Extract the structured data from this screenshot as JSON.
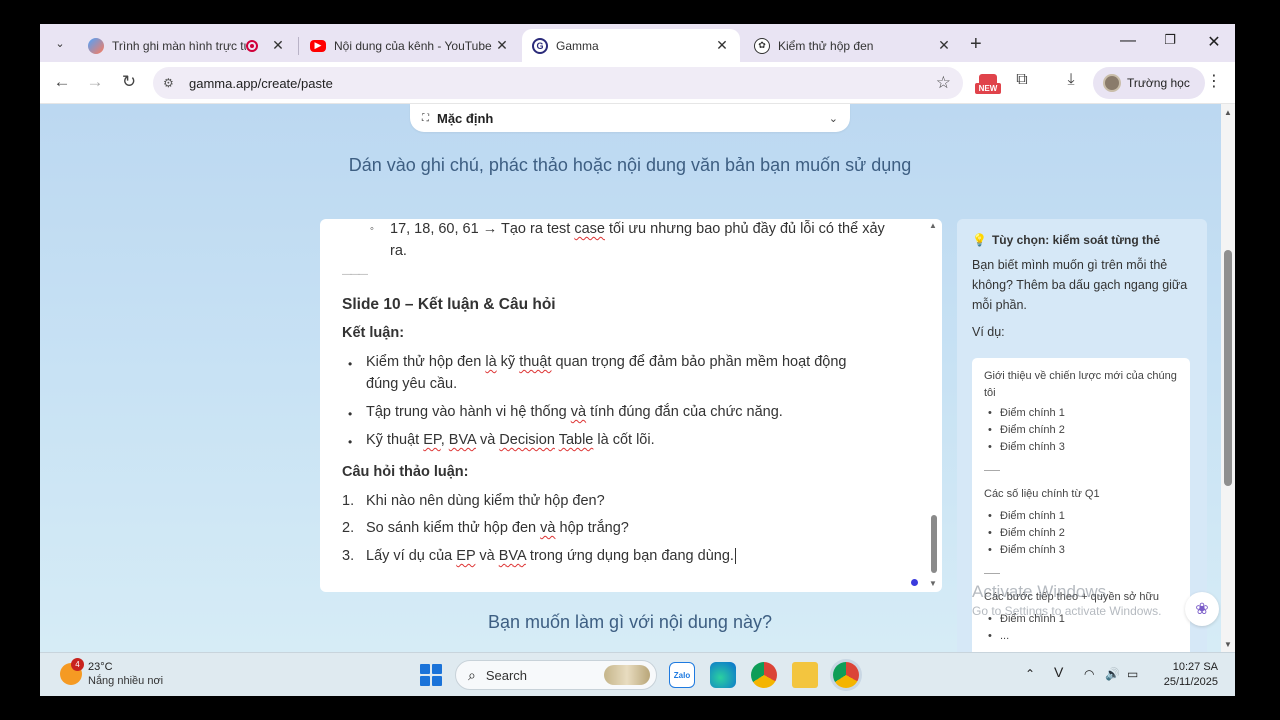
{
  "browser": {
    "tabs": [
      {
        "title": "Trình ghi màn hình trực tuyến",
        "active": false
      },
      {
        "title": "Nội dung của kênh - YouTube Studio",
        "active": false
      },
      {
        "title": "Gamma",
        "active": true
      },
      {
        "title": "Kiểm thử hộp đen",
        "active": false
      }
    ],
    "url": "gamma.app/create/paste",
    "new_badge": "NEW",
    "profile_name": "Trường học"
  },
  "page": {
    "mode_label": "Mặc định",
    "heading": "Dán vào ghi chú, phác thảo hoặc nội dung văn bản bạn muốn sử dụng",
    "question": "Bạn muốn làm gì với nội dung này?",
    "editor": {
      "sub_bullet_line1_pre": "17, 18, 60, 61 → Tạo ra test ",
      "sub_bullet_line1_err": "case",
      "sub_bullet_line1_post": " tối ưu nhưng bao phủ đầy đủ lỗi có thể xảy",
      "sub_bullet_line2": "ra.",
      "divider": "———",
      "slide_title": "Slide 10 – Kết luận & Câu hỏi",
      "conclusion_label": "Kết luận:",
      "bullet1_line1_pre": "Kiểm thử hộp đen ",
      "bullet1_line1_err": "là",
      "bullet1_line1_mid": " kỹ ",
      "bullet1_line1_err2": "thuật",
      "bullet1_line1_post": " quan trọng để đảm bảo phần mềm hoạt động",
      "bullet1_line2": "đúng yêu cầu.",
      "bullet2_pre": "Tập trung vào hành vi hệ thống ",
      "bullet2_err": "và",
      "bullet2_post": " tính đúng đắn của chức năng.",
      "bullet3_pre": "Kỹ thuật ",
      "bullet3_err1": "EP",
      "bullet3_sep": ", ",
      "bullet3_err2": "BVA",
      "bullet3_and": " và ",
      "bullet3_err3": "Decision",
      "bullet3_space": " ",
      "bullet3_err4": "Table",
      "bullet3_post": " là cốt lõi.",
      "discussion_label": "Câu hỏi thảo luận:",
      "q1_num": "1.",
      "q1": "Khi nào nên dùng kiểm thử hộp đen?",
      "q2_num": "2.",
      "q2_pre": "So sánh kiểm thử hộp đen ",
      "q2_err": "và",
      "q2_post": " hộp trắng?",
      "q3_num": "3.",
      "q3_pre": "Lấy ví dụ của ",
      "q3_err1": "EP",
      "q3_and": " và ",
      "q3_err2": "BVA",
      "q3_post": " trong ứng dụng bạn đang dùng."
    },
    "tips": {
      "title": "Tùy chọn: kiểm soát từng thẻ",
      "description": "Bạn biết mình muốn gì trên mỗi thẻ không? Thêm ba dấu gạch ngang  giữa mỗi phần.",
      "example_label": "Ví dụ:",
      "example": {
        "section1_title": "Giới thiệu về chiến lược mới của chúng tôi",
        "section1_items": [
          "Điểm chính 1",
          "Điểm chính 2",
          "Điểm chính 3"
        ],
        "section2_title": "Các số liệu chính từ Q1",
        "section2_items": [
          "Điểm chính 1",
          "Điểm chính 2",
          "Điểm chính 3"
        ],
        "section3_title": "Các bước tiếp theo + quyền sở hữu",
        "section3_items": [
          "Điểm chính 1",
          "..."
        ]
      }
    },
    "watermark": {
      "line1": "Activate Windows",
      "line2": "Go to Settings to activate Windows."
    }
  },
  "taskbar": {
    "weather_temp": "23°C",
    "weather_condition": "Nắng nhiều nơi",
    "weather_badge": "4",
    "search_placeholder": "Search",
    "time": "10:27 SA",
    "date": "25/11/2025"
  }
}
